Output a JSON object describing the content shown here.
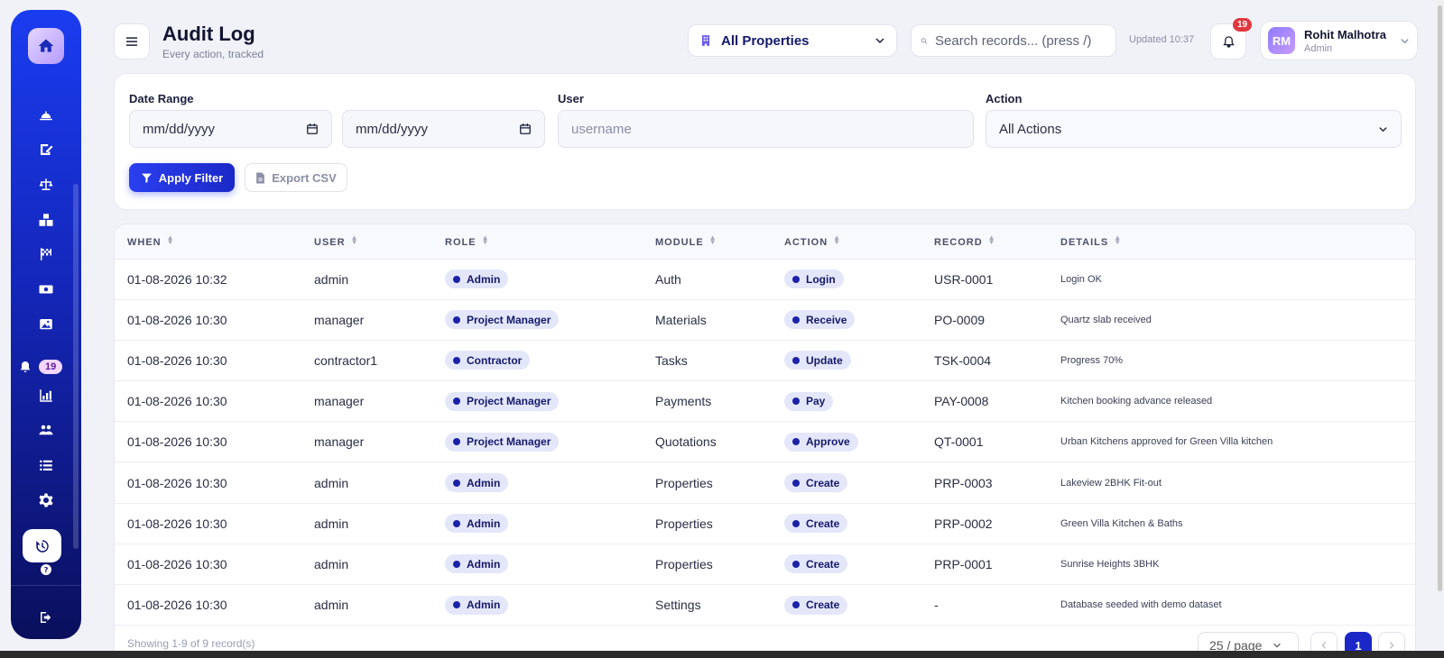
{
  "sidebar": {
    "bell_badge": "19",
    "icons": [
      "helmet-icon",
      "edit-icon",
      "scale-icon",
      "boxes-icon",
      "checkered-flag-icon",
      "money-icon",
      "images-icon",
      "chart-icon",
      "users-icon",
      "list-icon",
      "gear-icon",
      "history-icon",
      "help-icon",
      "logout-icon"
    ]
  },
  "header": {
    "title": "Audit Log",
    "subtitle": "Every action, tracked",
    "property_selector": "All Properties",
    "search_placeholder": "Search records... (press /)",
    "updated": "Updated 10:37",
    "notifications_badge": "19",
    "user": {
      "initials": "RM",
      "name": "Rohit Malhotra",
      "role": "Admin"
    }
  },
  "filters": {
    "date_range_label": "Date Range",
    "date_from": "mm/dd/yyyy",
    "date_to": "mm/dd/yyyy",
    "user_label": "User",
    "user_placeholder": "username",
    "action_label": "Action",
    "action_selected": "All Actions",
    "apply_label": "Apply Filter",
    "export_label": "Export CSV"
  },
  "table": {
    "columns": [
      "WHEN",
      "USER",
      "ROLE",
      "MODULE",
      "ACTION",
      "RECORD",
      "DETAILS"
    ],
    "rows": [
      {
        "when": "01-08-2026 10:32",
        "user": "admin",
        "role": "Admin",
        "module": "Auth",
        "action": "Login",
        "record": "USR-0001",
        "details": "Login OK"
      },
      {
        "when": "01-08-2026 10:30",
        "user": "manager",
        "role": "Project Manager",
        "module": "Materials",
        "action": "Receive",
        "record": "PO-0009",
        "details": "Quartz slab received"
      },
      {
        "when": "01-08-2026 10:30",
        "user": "contractor1",
        "role": "Contractor",
        "module": "Tasks",
        "action": "Update",
        "record": "TSK-0004",
        "details": "Progress 70%"
      },
      {
        "when": "01-08-2026 10:30",
        "user": "manager",
        "role": "Project Manager",
        "module": "Payments",
        "action": "Pay",
        "record": "PAY-0008",
        "details": "Kitchen booking advance released"
      },
      {
        "when": "01-08-2026 10:30",
        "user": "manager",
        "role": "Project Manager",
        "module": "Quotations",
        "action": "Approve",
        "record": "QT-0001",
        "details": "Urban Kitchens approved for Green Villa kitchen"
      },
      {
        "when": "01-08-2026 10:30",
        "user": "admin",
        "role": "Admin",
        "module": "Properties",
        "action": "Create",
        "record": "PRP-0003",
        "details": "Lakeview 2BHK Fit-out"
      },
      {
        "when": "01-08-2026 10:30",
        "user": "admin",
        "role": "Admin",
        "module": "Properties",
        "action": "Create",
        "record": "PRP-0002",
        "details": "Green Villa Kitchen & Baths"
      },
      {
        "when": "01-08-2026 10:30",
        "user": "admin",
        "role": "Admin",
        "module": "Properties",
        "action": "Create",
        "record": "PRP-0001",
        "details": "Sunrise Heights 3BHK"
      },
      {
        "when": "01-08-2026 10:30",
        "user": "admin",
        "role": "Admin",
        "module": "Settings",
        "action": "Create",
        "record": "-",
        "details": "Database seeded with demo dataset"
      }
    ],
    "footer_text": "Showing 1-9 of 9 record(s)",
    "per_page": "25 / page",
    "current_page": "1"
  }
}
